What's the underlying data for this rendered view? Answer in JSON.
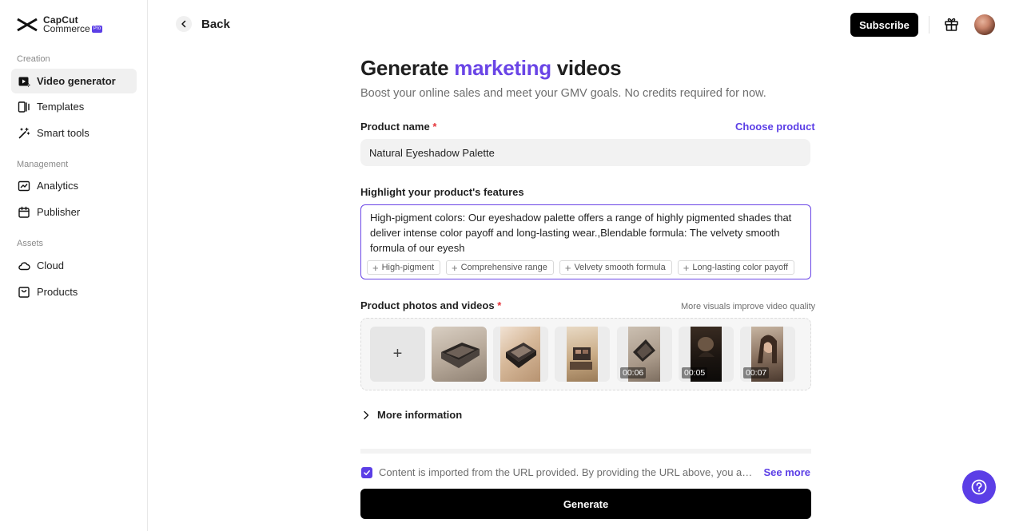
{
  "brand": {
    "name_line1": "CapCut",
    "name_line2": "Commerce",
    "badge": "Pro"
  },
  "sidebar": {
    "sections": [
      {
        "label": "Creation"
      },
      {
        "label": "Management"
      },
      {
        "label": "Assets"
      }
    ],
    "items": [
      {
        "label": "Video generator",
        "icon": "video-generator-icon",
        "active": true
      },
      {
        "label": "Templates",
        "icon": "templates-icon"
      },
      {
        "label": "Smart tools",
        "icon": "magic-wand-icon"
      },
      {
        "label": "Analytics",
        "icon": "analytics-icon"
      },
      {
        "label": "Publisher",
        "icon": "calendar-icon"
      },
      {
        "label": "Cloud",
        "icon": "cloud-icon"
      },
      {
        "label": "Products",
        "icon": "products-icon"
      }
    ]
  },
  "header": {
    "back_label": "Back",
    "subscribe_label": "Subscribe"
  },
  "main": {
    "title_prefix": "Generate ",
    "title_accent": "marketing",
    "title_suffix": " videos",
    "subtitle": "Boost your online sales and meet your GMV goals. No credits required for now.",
    "product_name": {
      "label": "Product name",
      "required_mark": "*",
      "action": "Choose product",
      "value": "Natural Eyeshadow Palette"
    },
    "features": {
      "label": "Highlight your product's features",
      "text": "High-pigment colors: Our eyeshadow palette offers a range of highly pigmented shades that deliver intense color payoff and long-lasting wear.,Blendable formula: The velvety smooth formula of our eyesh",
      "chips": [
        "High-pigment",
        "Comprehensive range",
        "Velvety smooth formula",
        "Long-lasting color payoff"
      ]
    },
    "media": {
      "label": "Product photos and videos",
      "required_mark": "*",
      "hint": "More visuals improve video quality",
      "items": [
        {
          "kind": "photo"
        },
        {
          "kind": "photo"
        },
        {
          "kind": "photo"
        },
        {
          "kind": "video",
          "duration": "00:06"
        },
        {
          "kind": "video",
          "duration": "00:05"
        },
        {
          "kind": "video",
          "duration": "00:07"
        }
      ]
    },
    "more_info_label": "More information",
    "consent": {
      "checked": true,
      "text": "Content is imported from the URL provided. By providing the URL above, you agree, reflecting your understanding and acceptance of the terms",
      "see_more": "See more"
    },
    "generate_label": "Generate"
  },
  "colors": {
    "accent": "#5b3ee6",
    "title_accent": "#6a45e6",
    "required": "#e5343a"
  }
}
